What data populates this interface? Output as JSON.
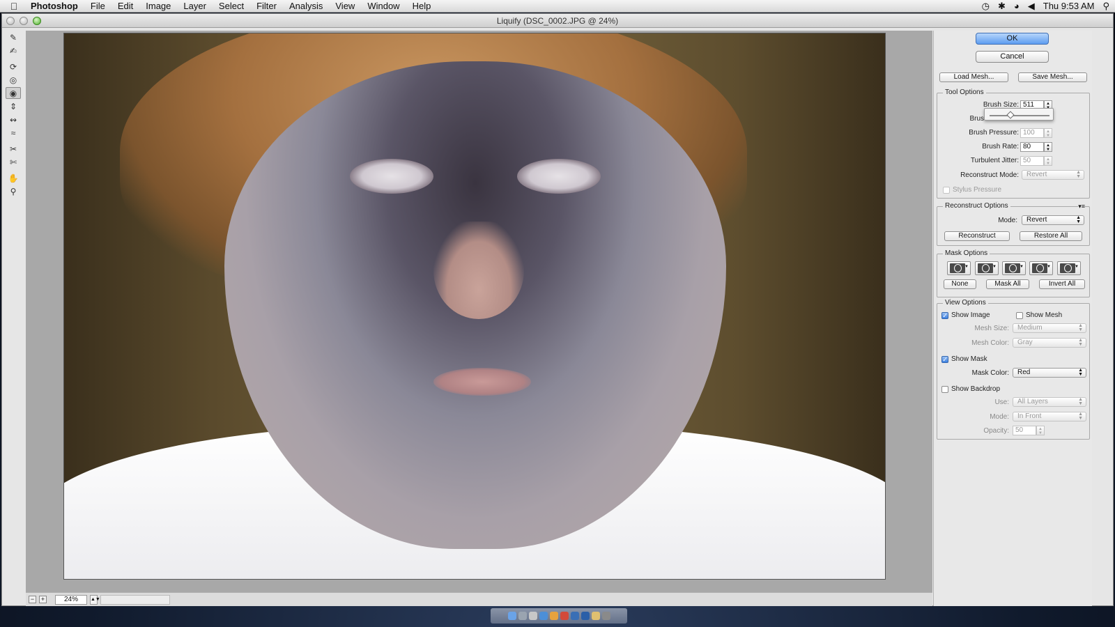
{
  "menubar": {
    "app": "Photoshop",
    "items": [
      "File",
      "Edit",
      "Image",
      "Layer",
      "Select",
      "Filter",
      "Analysis",
      "View",
      "Window",
      "Help"
    ],
    "clock": "Thu 9:53 AM"
  },
  "window": {
    "title": "Liquify (DSC_0002.JPG @ 24%)"
  },
  "tools": [
    "forward-warp-icon",
    "reconstruct-icon",
    "twirl-clockwise-icon",
    "pucker-icon",
    "bloat-icon",
    "push-left-icon",
    "mirror-icon",
    "turbulence-icon",
    "freeze-mask-icon",
    "thaw-mask-icon",
    "hand-icon",
    "zoom-icon"
  ],
  "statusbar": {
    "zoom": "24%"
  },
  "buttons": {
    "ok": "OK",
    "cancel": "Cancel",
    "load_mesh": "Load Mesh...",
    "save_mesh": "Save Mesh..."
  },
  "tool_options": {
    "title": "Tool Options",
    "brush_size_label": "Brush Size:",
    "brush_size": "511",
    "brush_density_label": "Brus",
    "brush_density_slider": 0.35,
    "brush_pressure_label": "Brush Pressure:",
    "brush_pressure": "100",
    "brush_rate_label": "Brush Rate:",
    "brush_rate": "80",
    "turbulent_jitter_label": "Turbulent Jitter:",
    "turbulent_jitter": "50",
    "reconstruct_mode_label": "Reconstruct Mode:",
    "reconstruct_mode": "Revert",
    "stylus_pressure_label": "Stylus Pressure"
  },
  "reconstruct_options": {
    "title": "Reconstruct Options",
    "mode_label": "Mode:",
    "mode": "Revert",
    "reconstruct": "Reconstruct",
    "restore_all": "Restore All"
  },
  "mask_options": {
    "title": "Mask Options",
    "none": "None",
    "mask_all": "Mask All",
    "invert_all": "Invert All"
  },
  "view_options": {
    "title": "View Options",
    "show_image": "Show Image",
    "show_mesh": "Show Mesh",
    "mesh_size_label": "Mesh Size:",
    "mesh_size": "Medium",
    "mesh_color_label": "Mesh Color:",
    "mesh_color": "Gray",
    "show_mask": "Show Mask",
    "mask_color_label": "Mask Color:",
    "mask_color": "Red",
    "show_backdrop": "Show Backdrop",
    "use_label": "Use:",
    "use": "All Layers",
    "mode_label": "Mode:",
    "mode": "In Front",
    "opacity_label": "Opacity:",
    "opacity": "50"
  },
  "colors": {
    "accent": "#5d9cf0",
    "panel": "#e8e8e8",
    "canvas": "#a8a8a8"
  }
}
